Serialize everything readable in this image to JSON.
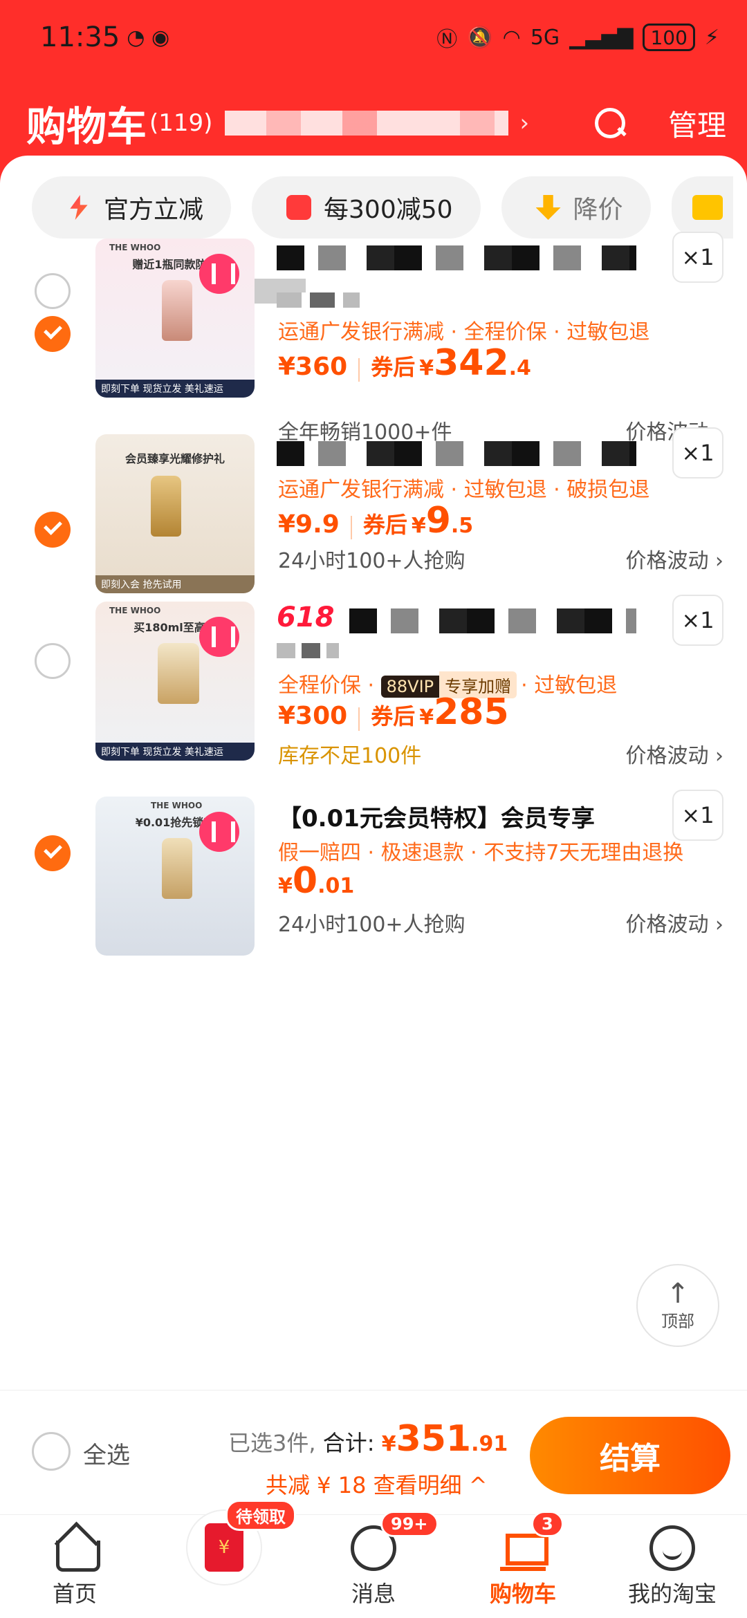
{
  "status_bar": {
    "time": "11:35",
    "network": "5G",
    "battery": "100"
  },
  "header": {
    "title": "购物车",
    "count": "(119)",
    "chevron": "›",
    "manage": "管理"
  },
  "chips": [
    {
      "label": "官方立减",
      "icon": "lightning-icon"
    },
    {
      "label": "每300减50",
      "icon": "coupon-icon"
    },
    {
      "label": "降价",
      "icon": "price-drop-icon"
    }
  ],
  "items": [
    {
      "checked": true,
      "thumb": {
        "brand": "THE WHOO",
        "headline": "赠近1瓶同款防晒",
        "strip": "即刻下单  现货立发 美礼速运"
      },
      "qty": "×1",
      "tags": "运通广发银行满减 · 全程价保 · 过敏包退",
      "price": "¥360",
      "after_label": "券后",
      "after_yen": "¥",
      "after_big": "342",
      "after_dec": ".4",
      "meta": "全年畅销1000+件",
      "wave": "价格波动 ›"
    },
    {
      "checked": true,
      "thumb": {
        "brand": "",
        "headline": "会员臻享光耀修护礼",
        "strip": "即刻入会 抢先试用"
      },
      "qty": "×1",
      "tags": "运通广发银行满减 · 过敏包退 · 破损包退",
      "price": "¥9.9",
      "after_label": "券后",
      "after_yen": "¥",
      "after_big": "9",
      "after_dec": ".5",
      "meta": "24小时100+人抢购",
      "wave": "价格波动 ›"
    },
    {
      "checked": false,
      "badge_618": "618",
      "thumb": {
        "brand": "THE WHOO",
        "headline": "买180ml至高享",
        "strip": "即刻下单  现货立发 美礼速运"
      },
      "qty": "×1",
      "tags_pre": "全程价保 · ",
      "vip_a": "88VIP",
      "vip_b": "专享加赠",
      "tags_post": "· 过敏包退",
      "price": "¥300",
      "after_label": "券后",
      "after_yen": "¥",
      "after_big": "285",
      "after_dec": "",
      "meta": "库存不足100件",
      "wave": "价格波动 ›"
    },
    {
      "checked": true,
      "name": "【0.01元会员特权】会员专享",
      "thumb": {
        "brand": "THE WHOO",
        "headline": "¥0.01抢先锁定",
        "strip": ""
      },
      "qty": "×1",
      "tags": "假一赔四 · 极速退款 · 不支持7天无理由退换",
      "price_yen": "¥",
      "price_big": "0",
      "price_dec": ".01",
      "meta": "24小时100+人抢购",
      "wave": "价格波动 ›"
    }
  ],
  "back_to_top": {
    "arrow": "↑",
    "label": "顶部"
  },
  "checkout": {
    "select_all": "全选",
    "selected": "已选3件,",
    "total_label": "合计:",
    "total_yen": "¥",
    "total_big": "351",
    "total_dec": ".91",
    "saving": "共减 ¥ 18  查看明细 ^",
    "pay": "结算"
  },
  "tabbar": [
    {
      "label": "首页",
      "icon": "home-icon"
    },
    {
      "label": "",
      "icon": "red-packet-icon",
      "badge": "待领取",
      "glyph": "¥"
    },
    {
      "label": "消息",
      "icon": "message-icon",
      "badge": "99+"
    },
    {
      "label": "购物车",
      "icon": "cart-icon",
      "badge": "3",
      "active": true
    },
    {
      "label": "我的淘宝",
      "icon": "profile-icon"
    }
  ],
  "colors": {
    "header": "#ff2e2a",
    "accent": "#ff5000",
    "check": "#ff6b10"
  }
}
